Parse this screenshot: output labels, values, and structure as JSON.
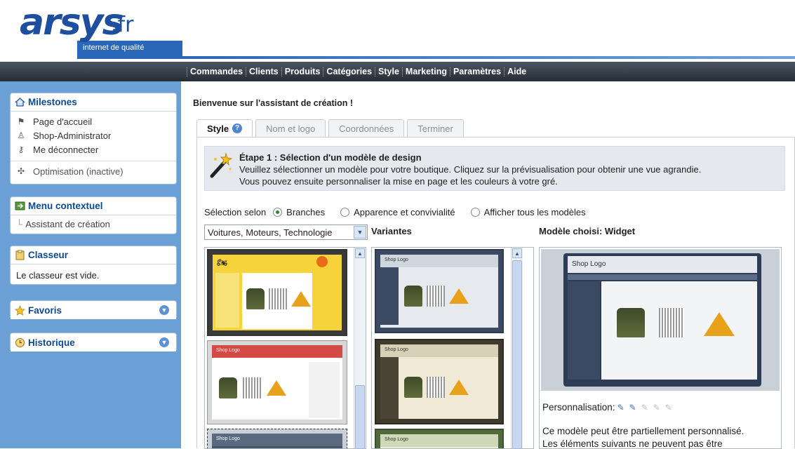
{
  "brand": {
    "name": "arsys",
    "tld": ".fr",
    "tagline": "internet de qualité"
  },
  "topnav": [
    "Commandes",
    "Clients",
    "Produits",
    "Catégories",
    "Style",
    "Marketing",
    "Paramètres",
    "Aide"
  ],
  "sidebar": {
    "milestones": {
      "title": "Milestones",
      "links": [
        "Page d'accueil",
        "Shop-Administrator",
        "Me déconnecter"
      ],
      "extra": "Optimisation (inactive)"
    },
    "menu": {
      "title": "Menu contextuel",
      "item": "Assistant de création"
    },
    "classeur": {
      "title": "Classeur",
      "text": "Le classeur est vide."
    },
    "favoris": {
      "title": "Favoris"
    },
    "historique": {
      "title": "Historique"
    }
  },
  "main": {
    "welcome": "Bienvenue sur l'assistant de création !",
    "tabs": [
      "Style",
      "Nom et logo",
      "Coordonnées",
      "Terminer"
    ],
    "step": {
      "title": "Étape 1 : Sélection d'un modèle de design",
      "desc1": "Veuillez sélectionner un modèle pour votre boutique. Cliquez sur la prévisualisation pour obtenir une vue agrandie.",
      "desc2": "Vous pouvez ensuite personnaliser la mise en page et les couleurs à votre gré."
    },
    "selection": {
      "label": "Sélection selon",
      "options": [
        "Branches",
        "Apparence et convivialité",
        "Afficher tous les modèles"
      ],
      "selected": "Branches"
    },
    "dropdown": "Voitures, Moteurs, Technologie",
    "variantes": "Variantes",
    "chosen": "Modèle choisi: Widget",
    "shop_logo": "Shop Logo",
    "personnalisation": "Personnalisation:",
    "personnalisation_level": "2/5",
    "preview_text1": "Ce modèle peut être partiellement personnalisé.",
    "preview_text2": "Les éléments suivants ne peuvent pas être"
  },
  "colors": {
    "brand_blue": "#1d4f9e",
    "nav_dark": "#2b323b",
    "sidebar_blue": "#6aa0d6",
    "yellow_template": "#f4cf2a",
    "red_template": "#d44a44"
  }
}
